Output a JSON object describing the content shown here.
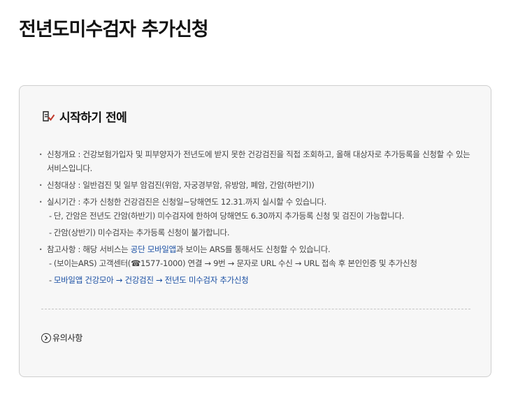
{
  "page": {
    "title": "전년도미수검자 추가신청"
  },
  "section": {
    "title": "시작하기 전에",
    "icon": "checklist-icon"
  },
  "info": {
    "overview": "신청개요 : 건강보험가입자 및 피부양자가 전년도에 받지 못한 건강검진을 직접 조회하고, 올해 대상자로 추가등록을 신청할 수 있는 서비스입니다.",
    "target": "신청대상 : 일반검진 및 일부 암검진(위암, 자궁경부암, 유방암, 폐암, 간암(하반기))",
    "period": "실시기간 : 추가 신청한 건강검진은 신청일~당해연도 12.31.까지 실시할 수 있습니다.",
    "period_sub1": "단, 간암은 전년도 간암(하반기) 미수검자에 한하여 당해연도 6.30까지 추가등록 신청 및 검진이 가능합니다.",
    "period_sub2": "간암(상반기) 미수검자는 추가등록 신청이 불가합니다.",
    "reference_prefix": "참고사항 : 해당 서비스는 ",
    "reference_link": "공단 모바일앱",
    "reference_suffix": "과 보이는 ARS를 통해서도 신청할 수 있습니다.",
    "reference_sub1": "(보이는ARS) 고객센터(☎1577-1000) 연결 → 9번 → 문자로 URL 수신 → URL 접속 후 본인인증 및 추가신청",
    "reference_sub2": "모바일앱 건강모아 → 건강검진 → 전년도 미수검자 추가신청",
    "dash": "-"
  },
  "notes": {
    "label": "유의사항",
    "icon": "chevron-right-circle-icon"
  },
  "colors": {
    "link": "#1a4fa3",
    "accent": "#c0392b",
    "panel_bg": "#f7f7f7",
    "border": "#cfcfcf"
  }
}
